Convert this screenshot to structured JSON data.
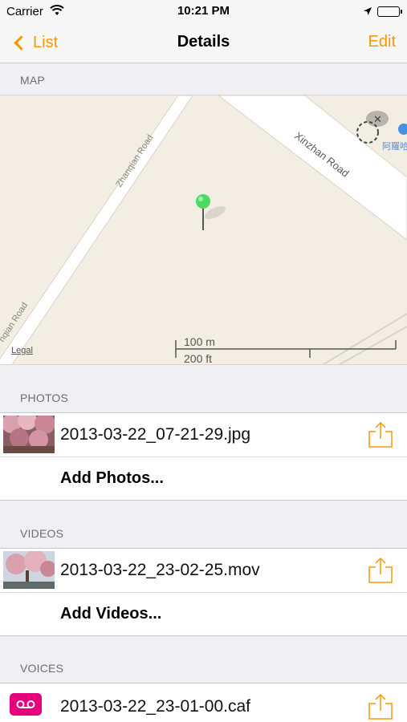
{
  "status_bar": {
    "carrier": "Carrier",
    "time": "10:21 PM"
  },
  "nav": {
    "back_label": "List",
    "title": "Details",
    "edit_label": "Edit"
  },
  "map": {
    "header": "MAP",
    "roads": [
      "Zhanqian Road",
      "Xinzhan Road",
      "nqian Road"
    ],
    "poi_label": "阿羅哈",
    "scale_metric": "100 m",
    "scale_imperial": "200 ft",
    "legal": "Legal"
  },
  "photos": {
    "header": "PHOTOS",
    "items": [
      {
        "file": "2013-03-22_07-21-29.jpg"
      }
    ],
    "add_label": "Add Photos..."
  },
  "videos": {
    "header": "VIDEOS",
    "items": [
      {
        "file": "2013-03-22_23-02-25.mov"
      }
    ],
    "add_label": "Add Videos..."
  },
  "voices": {
    "header": "VOICES",
    "items": [
      {
        "file": "2013-03-22_23-01-00.caf"
      }
    ]
  },
  "colors": {
    "accent": "#ff9500",
    "voice_icon": "#e6007e",
    "pin": "#4cd964"
  },
  "icons": [
    "wifi-icon",
    "location-arrow-icon",
    "battery-icon",
    "back-chevron-icon",
    "map-pin-icon",
    "share-icon",
    "voicemail-icon"
  ]
}
